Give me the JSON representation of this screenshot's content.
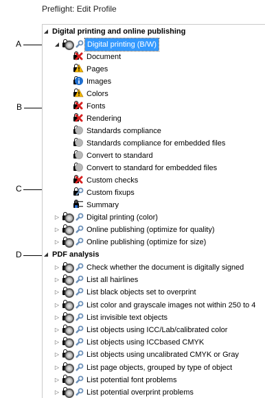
{
  "window": {
    "title": "Preflight: Edit Profile"
  },
  "callouts": {
    "a": "A",
    "b": "B",
    "c": "C",
    "d": "D"
  },
  "tree": {
    "section1": {
      "label": "Digital printing and online publishing"
    },
    "profile_bw": {
      "label": "Digital printing (B/W)",
      "children": [
        {
          "label": "Document",
          "icon": "error-x-icon"
        },
        {
          "label": "Pages",
          "icon": "warning-icon"
        },
        {
          "label": "Images",
          "icon": "info-icon"
        },
        {
          "label": "Colors",
          "icon": "warning-icon"
        },
        {
          "label": "Fonts",
          "icon": "error-x-icon"
        },
        {
          "label": "Rendering",
          "icon": "error-x-icon"
        },
        {
          "label": "Standards compliance",
          "icon": "inactive-icon"
        },
        {
          "label": "Standards compliance for embedded files",
          "icon": "inactive-icon"
        },
        {
          "label": "Convert to standard",
          "icon": "inactive-icon"
        },
        {
          "label": "Convert to standard for embedded files",
          "icon": "inactive-icon"
        },
        {
          "label": "Custom checks",
          "icon": "error-x-icon"
        },
        {
          "label": "Custom fixups",
          "icon": "wrench-icon"
        },
        {
          "label": "Summary",
          "icon": "summary-icon"
        }
      ]
    },
    "profiles_more": [
      {
        "label": "Digital printing (color)"
      },
      {
        "label": "Online publishing (optimize for quality)"
      },
      {
        "label": "Online publishing (optimize for size)"
      }
    ],
    "section2": {
      "label": "PDF analysis"
    },
    "analysis": [
      {
        "label": "Check whether the document is digitally signed"
      },
      {
        "label": "List all hairlines"
      },
      {
        "label": "List black objects set to overprint"
      },
      {
        "label": "List color and grayscale images not within 250 to 4"
      },
      {
        "label": "List invisible text objects"
      },
      {
        "label": "List objects using ICC/Lab/calibrated color"
      },
      {
        "label": "List objects using ICCbased CMYK"
      },
      {
        "label": "List objects using uncalibrated CMYK or Gray"
      },
      {
        "label": "List page objects, grouped by type of object"
      },
      {
        "label": "List potential font problems"
      },
      {
        "label": "List potential overprint problems"
      }
    ]
  },
  "colors": {
    "selection": "#3399ff",
    "error": "#d62020",
    "warning": "#f0b400",
    "info": "#1f6fd0"
  }
}
